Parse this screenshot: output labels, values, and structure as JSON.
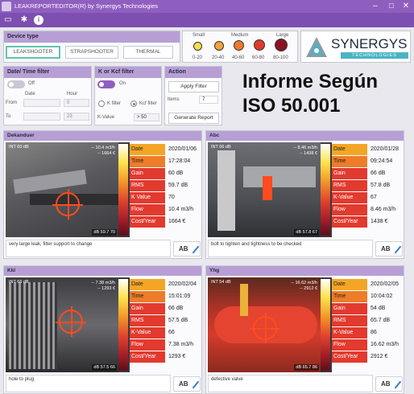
{
  "window": {
    "title": "LEAKREPORTEDITOR(R) by Synergys Technologies"
  },
  "toolbar": {
    "icons": [
      "folder-icon",
      "gear-icon",
      "info-icon"
    ]
  },
  "device_type": {
    "header": "Device type",
    "buttons": [
      "LEAKSHOOTER",
      "STRAPSHOOTER",
      "THERMAL"
    ],
    "selected": "LEAKSHOOTER"
  },
  "legend": {
    "items": [
      {
        "label": "Small",
        "range": "0-20",
        "color": "#f6dd4a"
      },
      {
        "label": "",
        "range": "20-40",
        "color": "#f2a23a"
      },
      {
        "label": "Medium",
        "range": "40-60",
        "color": "#ec7a2d"
      },
      {
        "label": "",
        "range": "60-80",
        "color": "#df3b2d"
      },
      {
        "label": "Large",
        "range": "80-100",
        "color": "#8a1222"
      }
    ]
  },
  "logo": {
    "name": "SYNERGYS",
    "sub": "TECHNOLOGIES"
  },
  "date_filter": {
    "header": "Date/ Time filter",
    "toggle": "Off",
    "col_date": "Date",
    "col_hour": "Hour",
    "from_label": "From",
    "to_label": "To",
    "from_hour": "0",
    "to_hour": "23"
  },
  "k_filter": {
    "header": "K or Kcf filter",
    "toggle": "On",
    "radio_k": "K filter",
    "radio_kcf": "Kcf filter",
    "kvalue_label": "K-Value",
    "kvalue": "> 50"
  },
  "action": {
    "header": "Action",
    "apply": "Apply Filter",
    "items_label": "Items",
    "items_count": "7",
    "generate": "Generate Report"
  },
  "report_title": {
    "line1": "Informe Según",
    "line2": "ISO 50.001"
  },
  "cards": [
    {
      "title": "Dekanduer",
      "overlay": [
        "-- 10.4 m3/h",
        "-- 1664 €"
      ],
      "tag": "INT 60 dB",
      "bottom": "dB 59.7  70",
      "date": "2020/01/06",
      "time": "17:28:04",
      "gain": "60 dB",
      "rms": "59.7 dB",
      "kvalue": "70",
      "flow": "10.4 m3/h",
      "cost": "1664 €",
      "comment": "very large leak, filter support to change",
      "scene": "#6b6b6b"
    },
    {
      "title": "Abc",
      "overlay": [
        "-- 8.46 m3/h",
        "-- 1438 €"
      ],
      "tag": "INT 66 dB",
      "bottom": "dB 57.8  67",
      "date": "2020/01/28",
      "time": "09:24:54",
      "gain": "66 dB",
      "rms": "57.8 dB",
      "kvalue": "67",
      "flow": "8.46 m3/h",
      "cost": "1438 €",
      "comment": "bolt to tighten and tightness to be checked",
      "scene": "#5e5f64"
    },
    {
      "title": "Kkl",
      "overlay": [
        "-- 7.38 m3/h",
        "-- 1293 €"
      ],
      "tag": "INT 66 dB",
      "bottom": "dB 57.5  66",
      "date": "2020/02/04",
      "time": "15:01:09",
      "gain": "66 dB",
      "rms": "57.5 dB",
      "kvalue": "66",
      "flow": "7.38 m3/h",
      "cost": "1293 €",
      "comment": "hole to plug",
      "scene": "#55555a"
    },
    {
      "title": "Yhg",
      "overlay": [
        "-- 16.62 m3/h",
        "-- 2912 €"
      ],
      "tag": "INT 54 dB",
      "bottom": "dB 65.7  86",
      "date": "2020/02/05",
      "time": "10:04:02",
      "gain": "54 dB",
      "rms": "65.7 dB",
      "kvalue": "86",
      "flow": "16.62 m3/h",
      "cost": "2912 €",
      "comment": "defective valve",
      "scene": "#c0392b"
    }
  ],
  "field_labels": {
    "date": "Date",
    "time": "Time",
    "gain": "Gain",
    "rms": "RMS",
    "kvalue": "K Value",
    "kvalue_alt": "K-Value",
    "flow": "Flow",
    "cost": "Cost/Year"
  },
  "ab_label": "AB"
}
